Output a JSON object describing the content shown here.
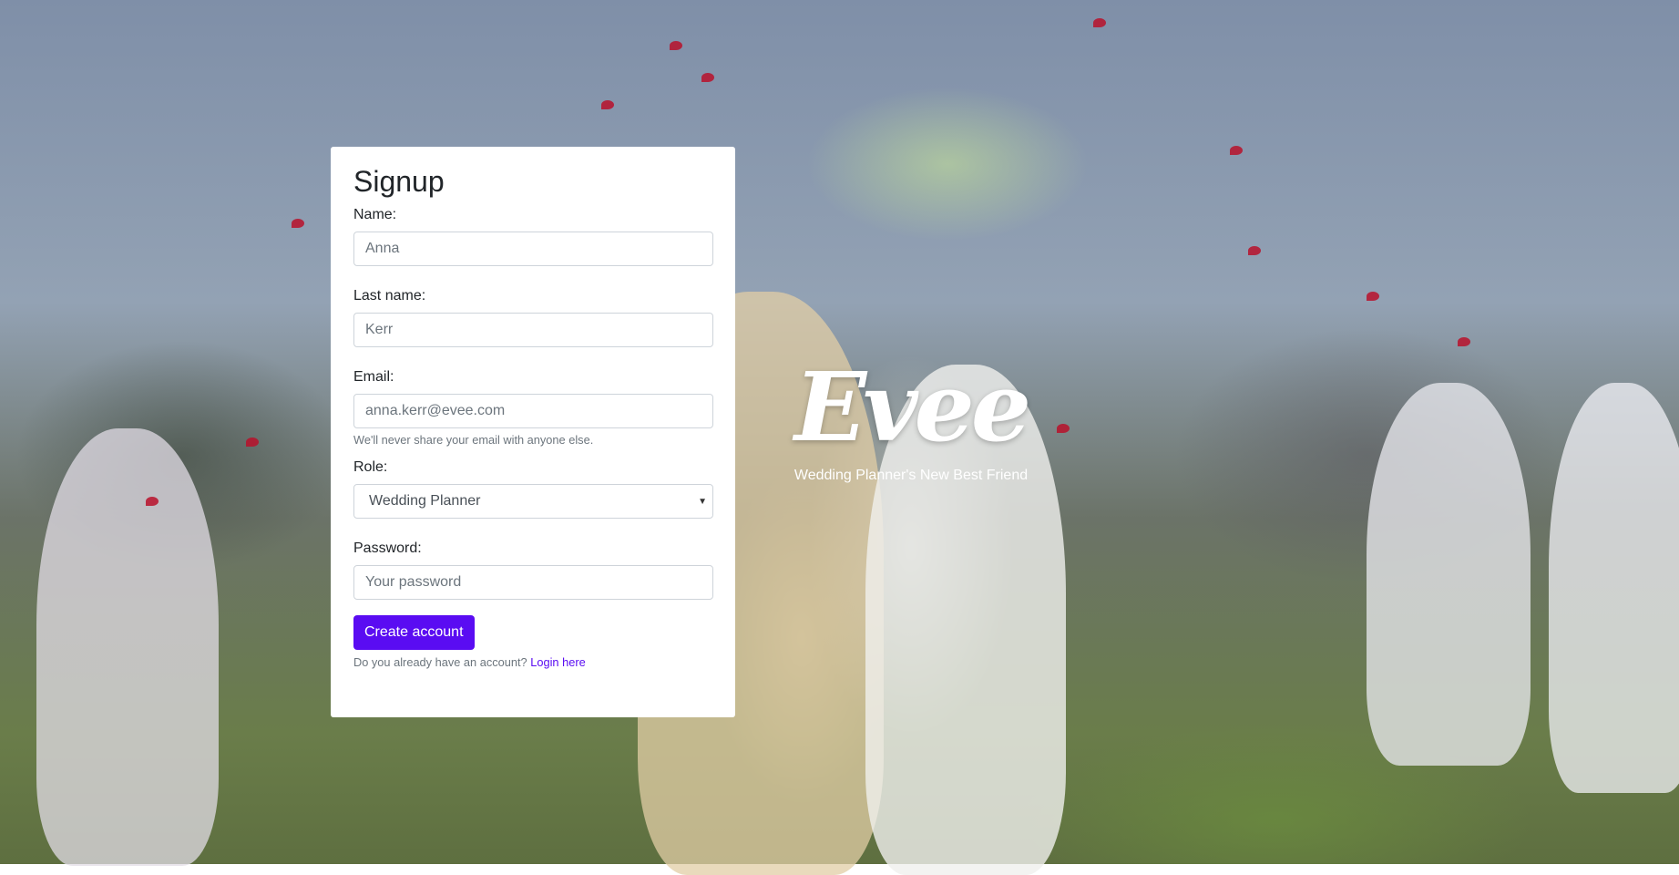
{
  "form": {
    "title": "Signup",
    "name_label": "Name:",
    "name_placeholder": "Anna",
    "lastname_label": "Last name:",
    "lastname_placeholder": "Kerr",
    "email_label": "Email:",
    "email_placeholder": "anna.kerr@evee.com",
    "email_help": "We'll never share your email with anyone else.",
    "role_label": "Role:",
    "role_selected": "Wedding Planner",
    "password_label": "Password:",
    "password_placeholder": "Your password",
    "submit_label": "Create account",
    "login_prompt": "Do you already have an account?",
    "login_link": "Login here"
  },
  "brand": {
    "logo": "Evee",
    "tagline": "Wedding Planner's New Best Friend"
  },
  "colors": {
    "accent": "#5a0cf2",
    "card_background": "#ffffff"
  },
  "icons": {
    "select_caret": "chevron-down-icon"
  }
}
